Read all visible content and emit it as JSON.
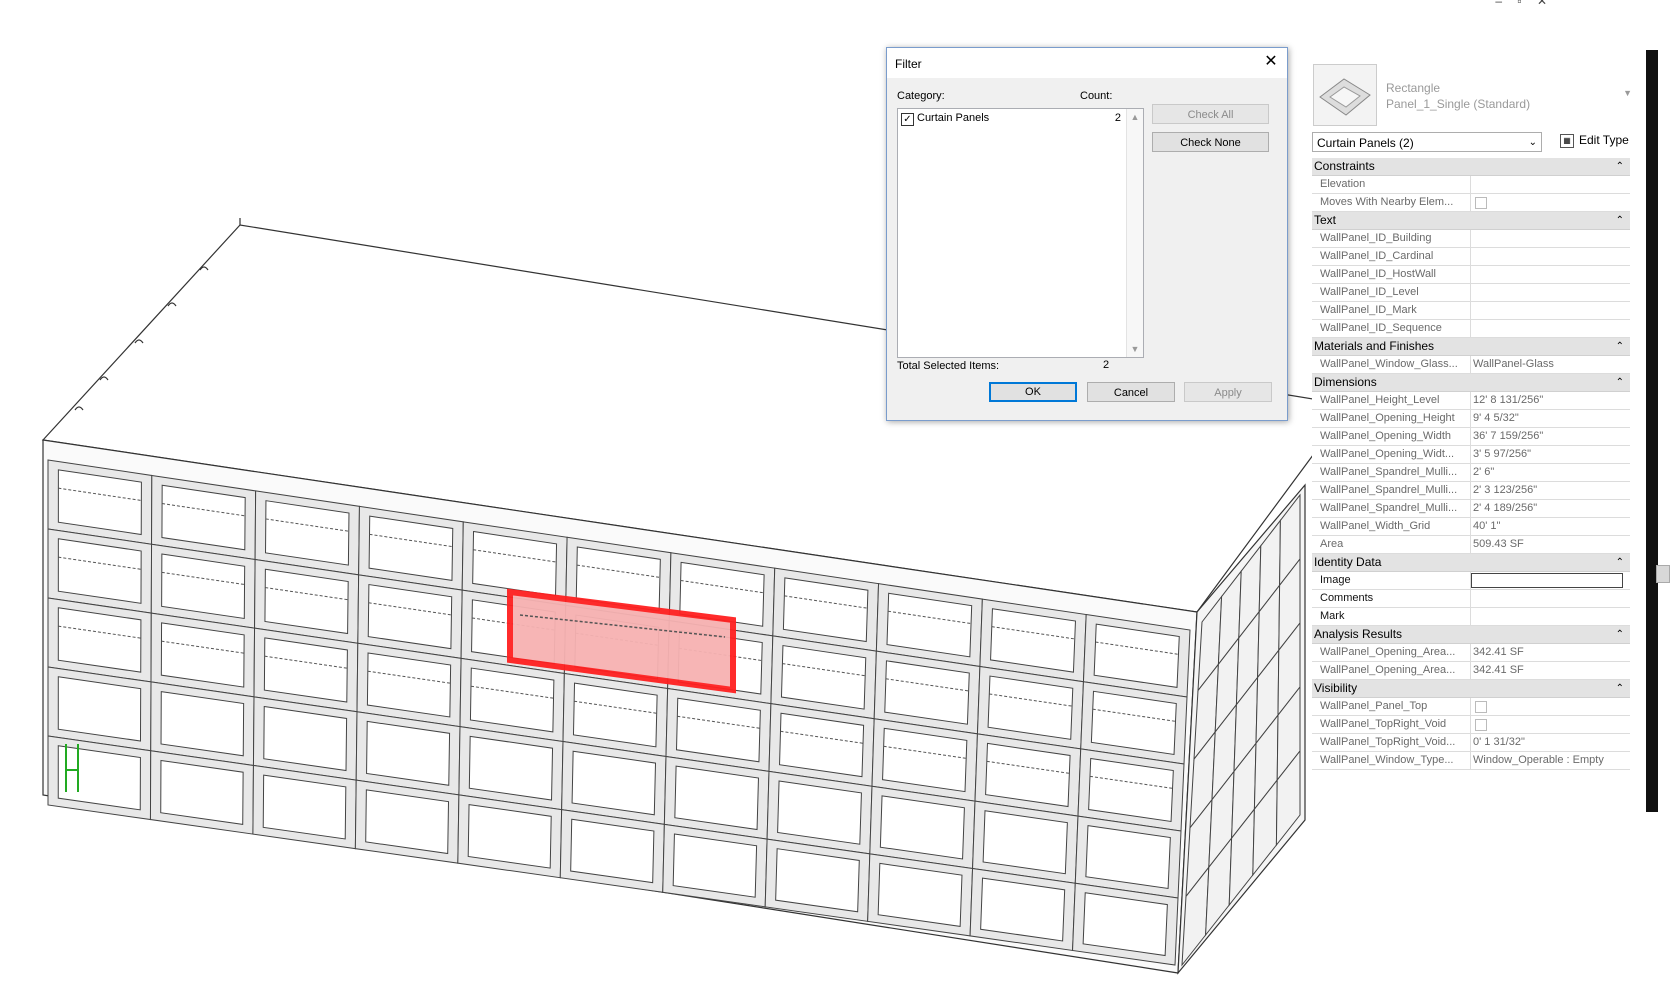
{
  "window_controls": "– ▫ ✕",
  "filter_dialog": {
    "title": "Filter",
    "category_label": "Category:",
    "count_label": "Count:",
    "categories": [
      {
        "name": "Curtain Panels",
        "count": "2",
        "checked": true
      }
    ],
    "check_all_label": "Check All",
    "check_none_label": "Check None",
    "total_label": "Total Selected Items:",
    "total_value": "2",
    "ok_label": "OK",
    "cancel_label": "Cancel",
    "apply_label": "Apply"
  },
  "properties": {
    "type_family": "Rectangle",
    "type_name": "Panel_1_Single (Standard)",
    "selector": "Curtain Panels (2)",
    "edit_type_label": "Edit Type",
    "groups": [
      {
        "title": "Constraints",
        "rows": [
          {
            "name": "Elevation",
            "value": ""
          },
          {
            "name": "Moves With Nearby Elem...",
            "value": "",
            "checkbox": true
          }
        ]
      },
      {
        "title": "Text",
        "rows": [
          {
            "name": "WallPanel_ID_Building",
            "value": ""
          },
          {
            "name": "WallPanel_ID_Cardinal",
            "value": ""
          },
          {
            "name": "WallPanel_ID_HostWall",
            "value": ""
          },
          {
            "name": "WallPanel_ID_Level",
            "value": ""
          },
          {
            "name": "WallPanel_ID_Mark",
            "value": ""
          },
          {
            "name": "WallPanel_ID_Sequence",
            "value": ""
          }
        ]
      },
      {
        "title": "Materials and Finishes",
        "rows": [
          {
            "name": "WallPanel_Window_Glass...",
            "value": "WallPanel-Glass"
          }
        ]
      },
      {
        "title": "Dimensions",
        "rows": [
          {
            "name": "WallPanel_Height_Level",
            "value": "12'  8 131/256\""
          },
          {
            "name": "WallPanel_Opening_Height",
            "value": "9'  4 5/32\""
          },
          {
            "name": "WallPanel_Opening_Width",
            "value": "36'  7 159/256\""
          },
          {
            "name": "WallPanel_Opening_Widt...",
            "value": "3'  5 97/256\""
          },
          {
            "name": "WallPanel_Spandrel_Mulli...",
            "value": "2'  6\""
          },
          {
            "name": "WallPanel_Spandrel_Mulli...",
            "value": "2'  3 123/256\""
          },
          {
            "name": "WallPanel_Spandrel_Mulli...",
            "value": "2'  4 189/256\""
          },
          {
            "name": "WallPanel_Width_Grid",
            "value": "40'  1\""
          },
          {
            "name": "Area",
            "value": "509.43 SF"
          }
        ]
      },
      {
        "title": "Identity Data",
        "rows": [
          {
            "name": "Image",
            "value": "",
            "box": true,
            "dark": true
          },
          {
            "name": "Comments",
            "value": "",
            "dark": true
          },
          {
            "name": "Mark",
            "value": "",
            "dark": true
          }
        ]
      },
      {
        "title": "Analysis Results",
        "rows": [
          {
            "name": "WallPanel_Opening_Area...",
            "value": "342.41 SF"
          },
          {
            "name": "WallPanel_Opening_Area...",
            "value": "342.41 SF"
          }
        ]
      },
      {
        "title": "Visibility",
        "rows": [
          {
            "name": "WallPanel_Panel_Top",
            "value": "",
            "checkbox": true
          },
          {
            "name": "WallPanel_TopRight_Void",
            "value": "",
            "checkbox": true
          },
          {
            "name": "WallPanel_TopRight_Void...",
            "value": "0'  1 31/32\""
          },
          {
            "name": "WallPanel_Window_Type...",
            "value": "Window_Operable : Empty"
          }
        ]
      }
    ]
  },
  "colors": {
    "selection": "#ff2020",
    "selection_fill": "#f7b2b2",
    "group_header": "#e3e3e3",
    "dialog_bg": "#f0f0f0"
  }
}
